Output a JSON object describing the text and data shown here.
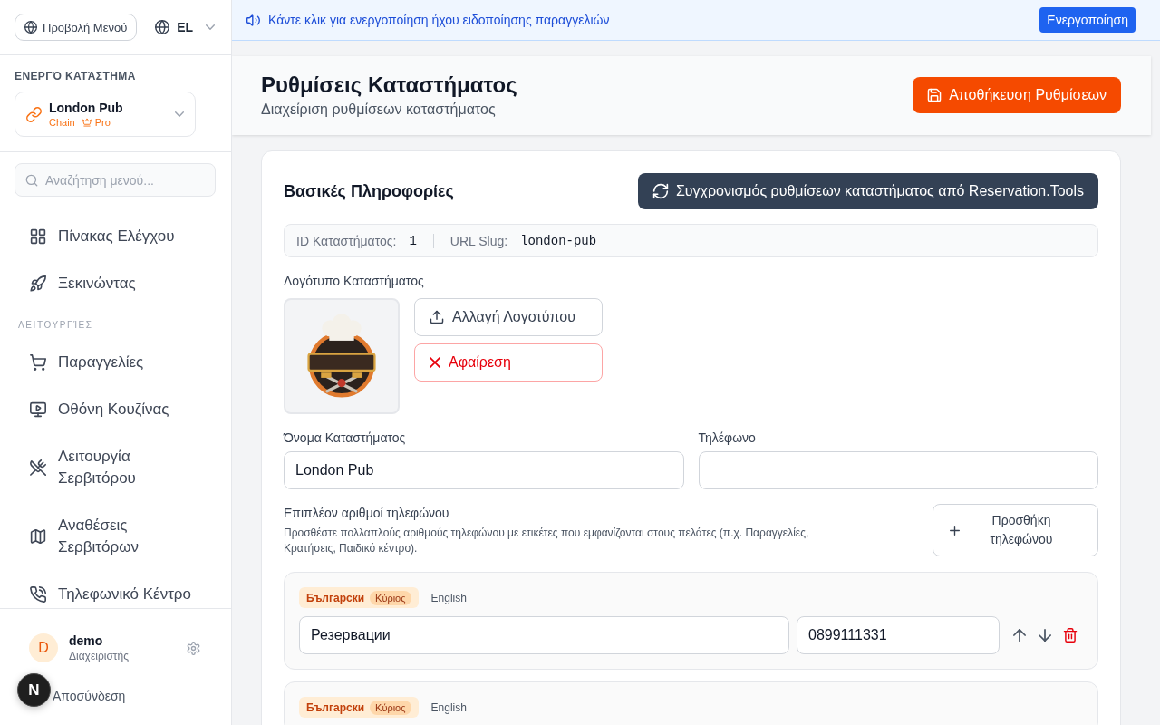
{
  "sidebar": {
    "menu_button": "Προβολή Μενού",
    "language": "EL",
    "active_store": {
      "heading": "ΕΝΕΡΓΌ ΚΑΤΆΣΤΗΜΑ",
      "name": "London Pub",
      "type": "Chain",
      "plan": "Pro"
    },
    "search": {
      "placeholder": "Αναζήτηση μενού..."
    },
    "nav_main": [
      {
        "label": "Πίνακας Ελέγχου",
        "selected": false
      },
      {
        "label": "Ξεκινώντας",
        "selected": false
      }
    ],
    "nav_section": {
      "title": "ΛΕΙΤΟΥΡΓΊΕΣ",
      "items": [
        {
          "label": "Παραγγελίες",
          "selected": false
        },
        {
          "label": "Οθόνη Κουζίνας",
          "selected": false
        },
        {
          "label": "Λειτουργία Σερβιτόρου",
          "selected": false
        },
        {
          "label": "Αναθέσεις Σερβιτόρων",
          "selected": false
        },
        {
          "label": "Τηλεφωνικό Κέντρο",
          "selected": false
        }
      ]
    },
    "user": {
      "initial": "D",
      "name": "demo",
      "role": "Διαχειριστής"
    },
    "logout": "Αποσύνδεση"
  },
  "dev_badge": "N",
  "banner": {
    "message": "Κάντε κλικ για ενεργοποίηση ήχου ειδοποίησης παραγγελιών",
    "button": "Ενεργοποίηση"
  },
  "header": {
    "title": "Ρυθμίσεις Καταστήματος",
    "subtitle": "Διαχείριση ρυθμίσεων καταστήματος",
    "save_button": "Αποθήκευση Ρυθμίσεων"
  },
  "basic_info": {
    "title": "Βασικές Πληροφορίες",
    "sync_button": "Συγχρονισμός ρυθμίσεων καταστήματος από Reservation.Tools",
    "id_label": "ID Καταστήματος:",
    "id_value": "1",
    "slug_label": "URL Slug:",
    "slug_value": "london-pub",
    "logo_label": "Λογότυπο Καταστήματος",
    "change_logo_button": "Αλλαγή Λογοτύπου",
    "remove_logo_button": "Αφαίρεση",
    "fields": [
      {
        "label": "Όνομα Καταστήματος",
        "value": "London Pub"
      },
      {
        "label": "Τηλέφωνο"
      }
    ],
    "extra_phones": {
      "title": "Επιπλέον αριθμοί τηλεφώνου",
      "description": "Προσθέστε πολλαπλούς αριθμούς τηλεφώνου με ετικέτες που εμφανίζονται στους πελάτες (π.χ. Παραγγελίες, Κρατήσεις, Παιδικό κέντρο).",
      "add_button": "Προσθήκη τηλεφώνου",
      "entries": [
        {
          "languages": [
            {
              "label": "Български",
              "badge": "Κύριος",
              "selected": true
            },
            {
              "label": "English",
              "selected": false
            }
          ],
          "label_value": "Резервации",
          "number": "0899111331"
        },
        {
          "languages": [
            {
              "label": "Български",
              "badge": "Κύριος",
              "selected": true
            },
            {
              "label": "English",
              "selected": false
            }
          ]
        }
      ]
    }
  }
}
